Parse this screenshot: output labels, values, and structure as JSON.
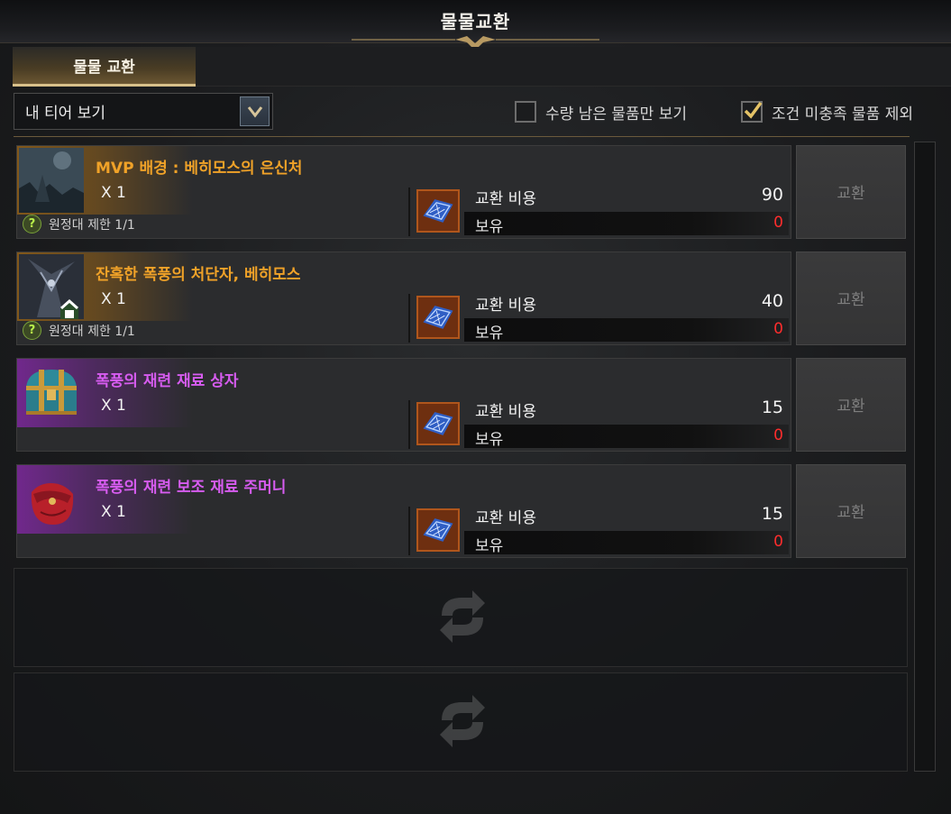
{
  "window": {
    "title": "물물교환"
  },
  "tab": {
    "label": "물물 교환"
  },
  "filter": {
    "dropdown_value": "내 티어 보기"
  },
  "checkboxes": [
    {
      "label": "수량 남은 물품만 보기",
      "checked": false
    },
    {
      "label": "조건 미충족 물품 제외",
      "checked": true
    }
  ],
  "items": [
    {
      "name": "MVP 배경 : 베히모스의 은신처",
      "grade_color": "orange",
      "quantity": "X 1",
      "limit": "원정대 제한 1/1",
      "cost_label": "교환 비용",
      "cost_value": "90",
      "owned_label": "보유",
      "owned_value": "0",
      "button": "교환",
      "icon": "mvp-background-icon"
    },
    {
      "name": "잔혹한 폭풍의 처단자, 베히모스",
      "grade_color": "orange",
      "quantity": "X 1",
      "limit": "원정대 제한 1/1",
      "cost_label": "교환 비용",
      "cost_value": "40",
      "owned_label": "보유",
      "owned_value": "0",
      "button": "교환",
      "icon": "behemoth-title-icon"
    },
    {
      "name": "폭풍의 재련 재료 상자",
      "grade_color": "purple",
      "quantity": "X 1",
      "limit": "",
      "cost_label": "교환 비용",
      "cost_value": "15",
      "owned_label": "보유",
      "owned_value": "0",
      "button": "교환",
      "icon": "treasure-chest-icon"
    },
    {
      "name": "폭풍의 재련 보조 재료 주머니",
      "grade_color": "purple",
      "quantity": "X 1",
      "limit": "",
      "cost_label": "교환 비용",
      "cost_value": "15",
      "owned_label": "보유",
      "owned_value": "0",
      "button": "교환",
      "icon": "red-pouch-icon"
    }
  ],
  "colors": {
    "orange_grade": "#f0a228",
    "purple_grade": "#d75cf0",
    "owned_zero": "#ff2d2d",
    "tab_accent": "#d8c08a"
  }
}
